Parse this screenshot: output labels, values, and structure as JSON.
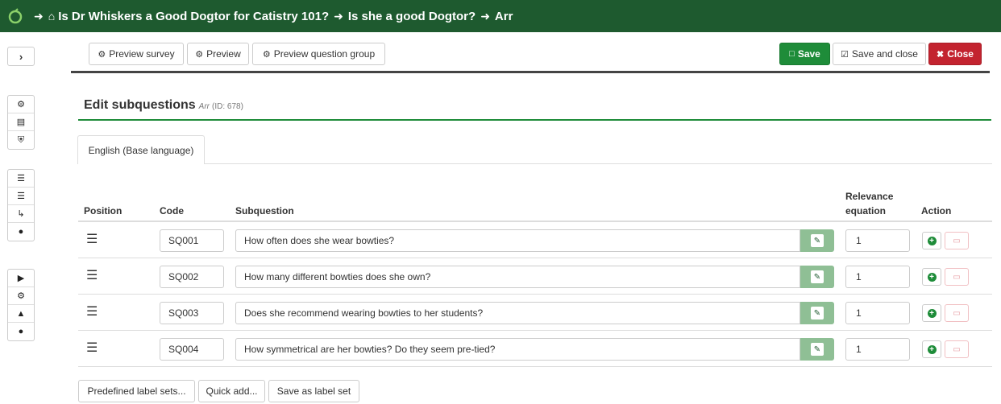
{
  "breadcrumb": {
    "survey": "Is Dr Whiskers a Good Dogtor for Catistry 101?",
    "group": "Is she a good Dogtor?",
    "question": "Arr"
  },
  "toolbar": {
    "preview_survey": "Preview survey",
    "preview": "Preview",
    "preview_group": "Preview question group",
    "save": "Save",
    "save_close": "Save and close",
    "close": "Close"
  },
  "heading": {
    "title": "Edit subquestions",
    "code": "Arr",
    "id_text": "(ID: 678)"
  },
  "tabs": [
    {
      "label": "English (Base language)"
    }
  ],
  "table": {
    "headers": {
      "position": "Position",
      "code": "Code",
      "subquestion": "Subquestion",
      "relevance_line1": "Relevance",
      "relevance_line2": "equation",
      "action": "Action"
    },
    "rows": [
      {
        "code": "SQ001",
        "subquestion": "How often does she wear bowties?",
        "relevance": "1"
      },
      {
        "code": "SQ002",
        "subquestion": "How many different bowties does she own?",
        "relevance": "1"
      },
      {
        "code": "SQ003",
        "subquestion": "Does she recommend wearing bowties to her students?",
        "relevance": "1"
      },
      {
        "code": "SQ004",
        "subquestion": "How symmetrical are her bowties? Do they seem pre-tied?",
        "relevance": "1"
      }
    ]
  },
  "footer": {
    "predefined": "Predefined label sets...",
    "quick_add": "Quick add...",
    "save_label_set": "Save as label set"
  },
  "colors": {
    "topbar": "#1e5a2f",
    "accent": "#1e8c39",
    "danger": "#c3232f"
  }
}
